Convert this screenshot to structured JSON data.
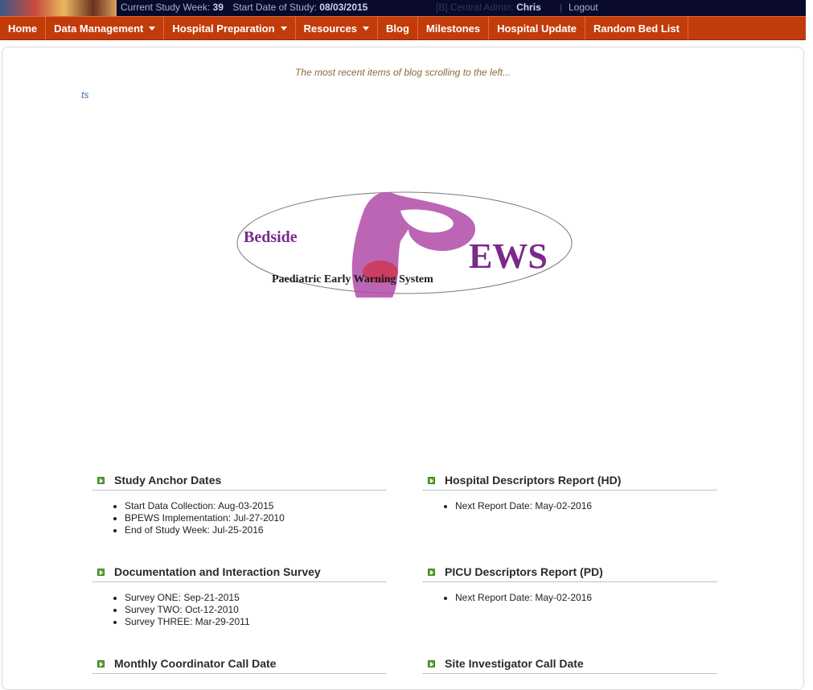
{
  "status_bar": {
    "week_label": "Current Study Week:",
    "week_value": "39",
    "start_label": "Start Date of Study:",
    "start_value": "08/03/2015",
    "admin_label": "[B] Central Admin:",
    "admin_name": "Chris",
    "separator": "|",
    "logout": "Logout"
  },
  "nav": [
    {
      "label": "Home",
      "dropdown": false
    },
    {
      "label": "Data Management",
      "dropdown": true
    },
    {
      "label": "Hospital Preparation",
      "dropdown": true
    },
    {
      "label": "Resources",
      "dropdown": true
    },
    {
      "label": "Blog",
      "dropdown": false
    },
    {
      "label": "Milestones",
      "dropdown": false
    },
    {
      "label": "Hospital Update",
      "dropdown": false
    },
    {
      "label": "Random Bed List",
      "dropdown": false
    }
  ],
  "ticker": {
    "caption": "The most recent items of blog scrolling to the left...",
    "text": "ts"
  },
  "logo": {
    "word1": "Bedside",
    "word2": "EWS",
    "tagline": "Paediatric Early Warning System"
  },
  "sections": {
    "anchor": {
      "title": "Study Anchor Dates",
      "items": [
        "Start Data Collection: Aug-03-2015",
        "BPEWS Implementation: Jul-27-2010",
        "End of Study Week: Jul-25-2016"
      ]
    },
    "hospital_report": {
      "title": "Hospital Descriptors Report (HD)",
      "items": [
        "Next Report Date: May-02-2016"
      ]
    },
    "survey": {
      "title": "Documentation and Interaction Survey",
      "items": [
        "Survey ONE: Sep-21-2015",
        "Survey TWO: Oct-12-2010",
        "Survey THREE: Mar-29-2011"
      ]
    },
    "picu_report": {
      "title": "PICU Descriptors Report (PD)",
      "items": [
        "Next Report Date: May-02-2016"
      ]
    },
    "coordinator_call": {
      "title": "Monthly Coordinator Call Date",
      "items": []
    },
    "investigator_call": {
      "title": "Site Investigator Call Date",
      "items": []
    }
  },
  "colors": {
    "nav_bg": "#c23c0b",
    "topbar_bg": "#0a0a2a",
    "logo_purple": "#7a2a8a",
    "toggle_green": "#5aa632"
  }
}
